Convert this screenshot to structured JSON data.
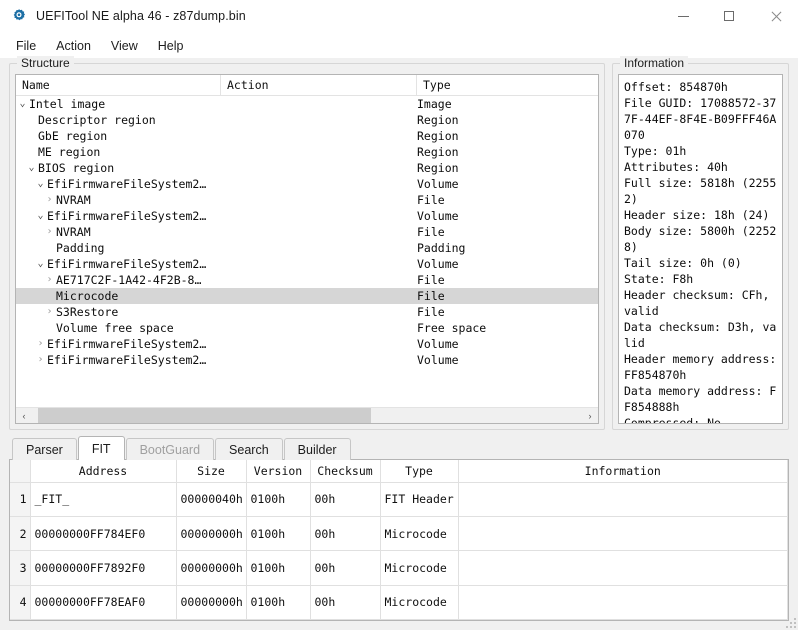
{
  "window": {
    "title": "UEFITool NE alpha 46 - z87dump.bin",
    "app_icon": "gear-icon",
    "minimize": "minimize-icon",
    "maximize": "maximize-icon",
    "close": "close-icon"
  },
  "menubar": {
    "items": [
      {
        "label": "File"
      },
      {
        "label": "Action"
      },
      {
        "label": "View"
      },
      {
        "label": "Help"
      }
    ]
  },
  "structure": {
    "group_title": "Structure",
    "columns": [
      "Name",
      "Action",
      "Type"
    ],
    "scroll": {
      "left_arrow": "‹",
      "right_arrow": "›"
    },
    "rows": [
      {
        "indent": 0,
        "twist": "expanded",
        "name": "Intel image",
        "action": "",
        "type": "Image",
        "selected": false
      },
      {
        "indent": 1,
        "twist": "none",
        "name": "Descriptor region",
        "action": "",
        "type": "Region",
        "selected": false
      },
      {
        "indent": 1,
        "twist": "none",
        "name": "GbE region",
        "action": "",
        "type": "Region",
        "selected": false
      },
      {
        "indent": 1,
        "twist": "none",
        "name": "ME region",
        "action": "",
        "type": "Region",
        "selected": false
      },
      {
        "indent": 1,
        "twist": "expanded",
        "name": "BIOS region",
        "action": "",
        "type": "Region",
        "selected": false
      },
      {
        "indent": 2,
        "twist": "expanded",
        "name": "EfiFirmwareFileSystem2…",
        "action": "",
        "type": "Volume",
        "selected": false
      },
      {
        "indent": 3,
        "twist": "collapsed",
        "name": "NVRAM",
        "action": "",
        "type": "File",
        "selected": false
      },
      {
        "indent": 2,
        "twist": "expanded",
        "name": "EfiFirmwareFileSystem2…",
        "action": "",
        "type": "Volume",
        "selected": false
      },
      {
        "indent": 3,
        "twist": "collapsed",
        "name": "NVRAM",
        "action": "",
        "type": "File",
        "selected": false
      },
      {
        "indent": 3,
        "twist": "none",
        "name": "Padding",
        "action": "",
        "type": "Padding",
        "selected": false
      },
      {
        "indent": 2,
        "twist": "expanded",
        "name": "EfiFirmwareFileSystem2…",
        "action": "",
        "type": "Volume",
        "selected": false
      },
      {
        "indent": 3,
        "twist": "collapsed",
        "name": "AE717C2F-1A42-4F2B-8…",
        "action": "",
        "type": "File",
        "selected": false
      },
      {
        "indent": 3,
        "twist": "none",
        "name": "Microcode",
        "action": "",
        "type": "File",
        "selected": true
      },
      {
        "indent": 3,
        "twist": "collapsed",
        "name": "S3Restore",
        "action": "",
        "type": "File",
        "selected": false
      },
      {
        "indent": 3,
        "twist": "none",
        "name": "Volume free space",
        "action": "",
        "type": "Free space",
        "selected": false
      },
      {
        "indent": 2,
        "twist": "collapsed",
        "name": "EfiFirmwareFileSystem2…",
        "action": "",
        "type": "Volume",
        "selected": false
      },
      {
        "indent": 2,
        "twist": "collapsed",
        "name": "EfiFirmwareFileSystem2…",
        "action": "",
        "type": "Volume",
        "selected": false
      }
    ]
  },
  "information": {
    "group_title": "Information",
    "text": "Offset: 854870h\nFile GUID: 17088572-377F-44EF-8F4E-B09FFF46A070\nType: 01h\nAttributes: 40h\nFull size: 5818h (22552)\nHeader size: 18h (24)\nBody size: 5800h (22528)\nTail size: 0h (0)\nState: F8h\nHeader checksum: CFh, valid\nData checksum: D3h, valid\nHeader memory address: FF854870h\nData memory address: FF854888h\nCompressed: No\nFixed: No"
  },
  "tabs": [
    {
      "label": "Parser",
      "active": false,
      "disabled": false
    },
    {
      "label": "FIT",
      "active": true,
      "disabled": false
    },
    {
      "label": "BootGuard",
      "active": false,
      "disabled": true
    },
    {
      "label": "Search",
      "active": false,
      "disabled": false
    },
    {
      "label": "Builder",
      "active": false,
      "disabled": false
    }
  ],
  "fit_table": {
    "columns": [
      "Address",
      "Size",
      "Version",
      "Checksum",
      "Type",
      "Information"
    ],
    "rows": [
      {
        "num": "1",
        "address": "_FIT_",
        "size": "00000040h",
        "version": "0100h",
        "checksum": "00h",
        "type": "FIT Header",
        "information": ""
      },
      {
        "num": "2",
        "address": "00000000FF784EF0",
        "size": "00000000h",
        "version": "0100h",
        "checksum": "00h",
        "type": "Microcode",
        "information": ""
      },
      {
        "num": "3",
        "address": "00000000FF7892F0",
        "size": "00000000h",
        "version": "0100h",
        "checksum": "00h",
        "type": "Microcode",
        "information": ""
      },
      {
        "num": "4",
        "address": "00000000FF78EAF0",
        "size": "00000000h",
        "version": "0100h",
        "checksum": "00h",
        "type": "Microcode",
        "information": ""
      }
    ]
  },
  "colors": {
    "accent": "#1d6fa5",
    "selection": "#d6d6d6",
    "window_bg": "#f0f0f0",
    "pane_bg": "#ffffff",
    "border": "#b4b4b4"
  }
}
